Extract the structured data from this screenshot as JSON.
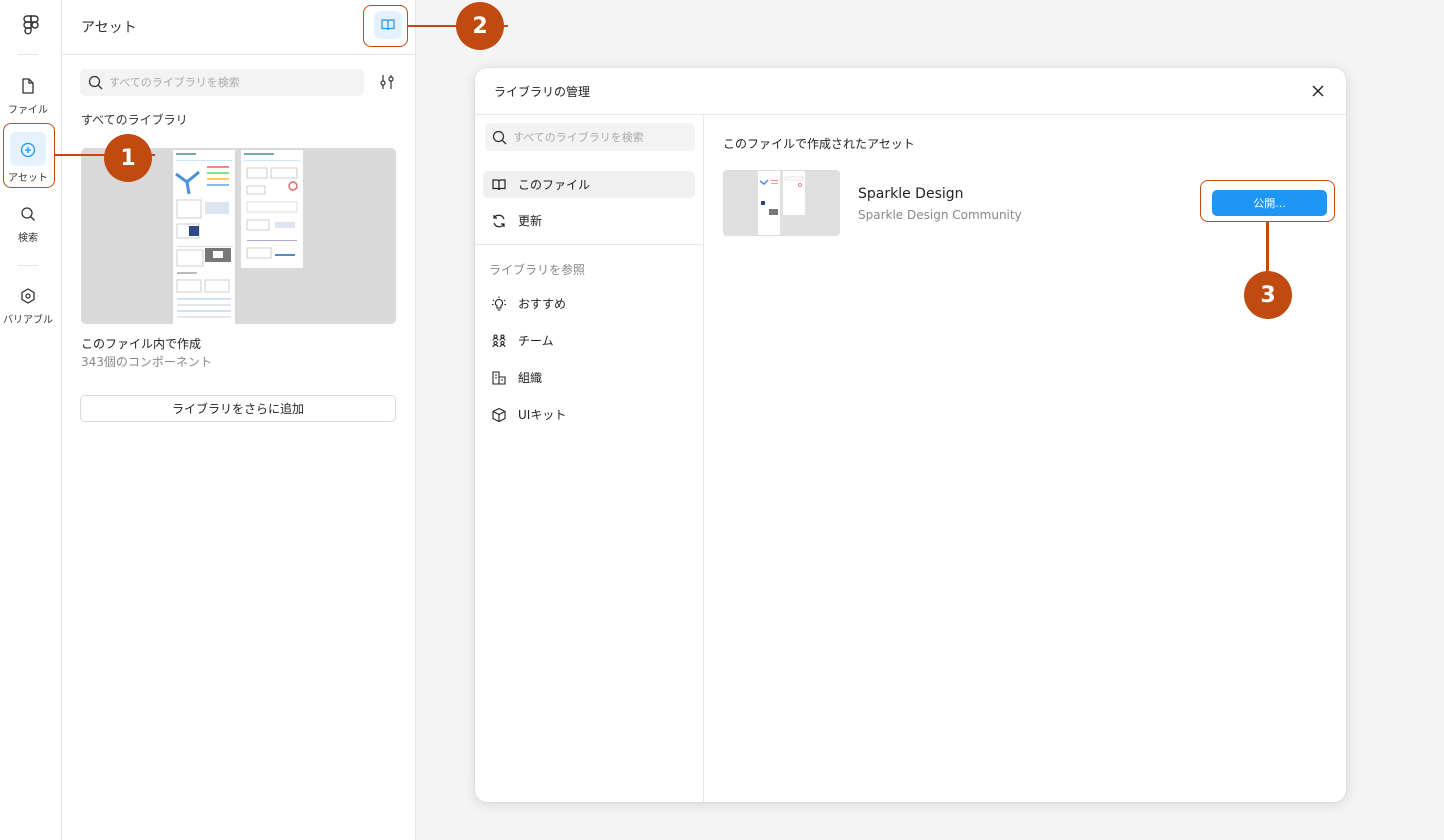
{
  "rail": {
    "items": [
      {
        "label": "ファイル",
        "icon": "file-icon"
      },
      {
        "label": "アセット",
        "icon": "assets-icon"
      },
      {
        "label": "検索",
        "icon": "search-icon"
      },
      {
        "label": "バリアブル",
        "icon": "variables-icon"
      }
    ]
  },
  "panel": {
    "title": "アセット",
    "search_placeholder": "すべてのライブラリを検索",
    "section_label": "すべてのライブラリ",
    "library": {
      "name": "このファイル内で作成",
      "count": "343個のコンポーネント"
    },
    "add_button": "ライブラリをさらに追加"
  },
  "modal": {
    "title": "ライブラリの管理",
    "search_placeholder": "すべてのライブラリを検索",
    "nav_top": [
      {
        "label": "このファイル",
        "icon": "book-icon",
        "active": true
      },
      {
        "label": "更新",
        "icon": "refresh-icon",
        "active": false
      }
    ],
    "browse_heading": "ライブラリを参照",
    "nav_browse": [
      {
        "label": "おすすめ",
        "icon": "lightbulb-icon"
      },
      {
        "label": "チーム",
        "icon": "team-icon"
      },
      {
        "label": "組織",
        "icon": "organization-icon"
      },
      {
        "label": "UIキット",
        "icon": "box-icon"
      }
    ],
    "main_heading": "このファイルで作成されたアセット",
    "file": {
      "name": "Sparkle Design",
      "subtitle": "Sparkle Design Community"
    },
    "publish_button": "公開..."
  },
  "annotations": [
    {
      "number": "1"
    },
    {
      "number": "2"
    },
    {
      "number": "3"
    }
  ],
  "colors": {
    "accent": "#1e96f5",
    "annotation": "#c04a10",
    "active_bg": "#e5f1fd"
  }
}
